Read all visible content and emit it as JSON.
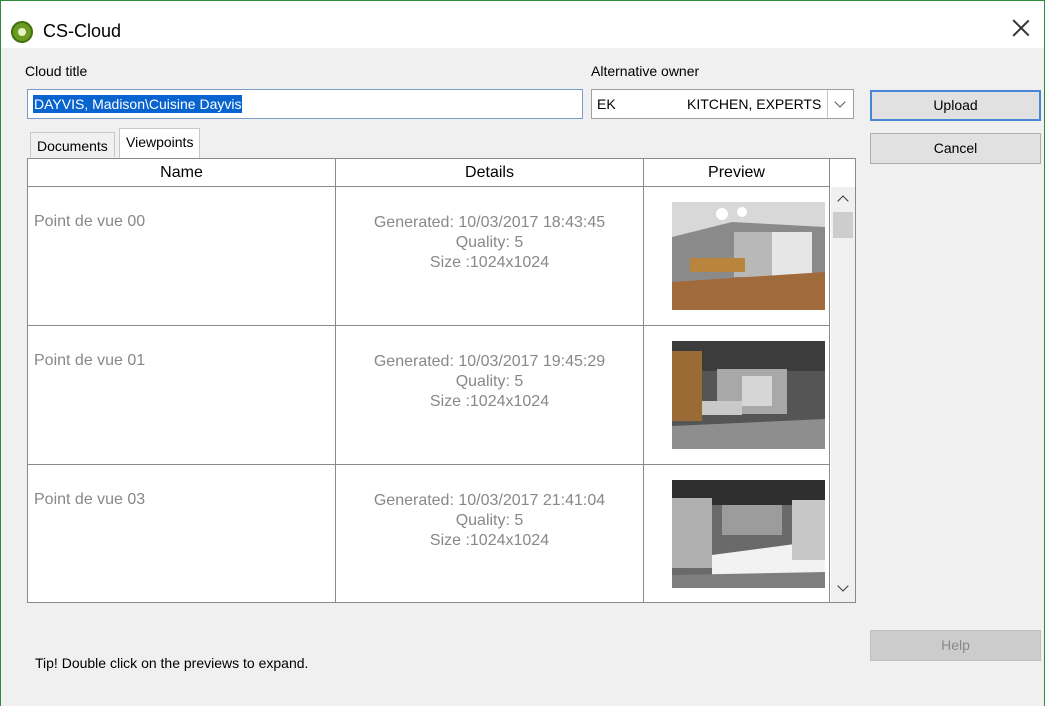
{
  "window": {
    "title": "CS-Cloud"
  },
  "form": {
    "cloud_title_label": "Cloud title",
    "cloud_title_value": "DAYVIS, Madison\\Cuisine Dayvis",
    "alt_owner_label": "Alternative owner",
    "alt_owner_code": "EK",
    "alt_owner_name": "KITCHEN, EXPERTS"
  },
  "buttons": {
    "upload": "Upload",
    "cancel": "Cancel",
    "help": "Help"
  },
  "tabs": [
    {
      "label": "Documents",
      "active": false
    },
    {
      "label": "Viewpoints",
      "active": true
    }
  ],
  "grid": {
    "columns": [
      "Name",
      "Details",
      "Preview"
    ],
    "rows": [
      {
        "name": "Point de vue 00",
        "generated": "Generated: 10/03/2017 18:43:45",
        "quality": "Quality: 5",
        "size": "Size :1024x1024"
      },
      {
        "name": "Point de vue 01",
        "generated": "Generated: 10/03/2017 19:45:29",
        "quality": "Quality: 5",
        "size": "Size :1024x1024"
      },
      {
        "name": "Point de vue 03",
        "generated": "Generated: 10/03/2017 21:41:04",
        "quality": "Quality: 5",
        "size": "Size :1024x1024"
      }
    ]
  },
  "tip": "Tip! Double click on the previews to expand.",
  "icons": {
    "app": "cs-cloud-logo-icon",
    "close": "close-icon",
    "dropdown": "chevron-down-icon",
    "scroll_up": "chevron-up-icon",
    "scroll_down": "chevron-down-icon"
  },
  "colors": {
    "selection": "#0a64d0",
    "window_border": "#2e8b3a",
    "primary_button_border": "#4a86d6"
  }
}
